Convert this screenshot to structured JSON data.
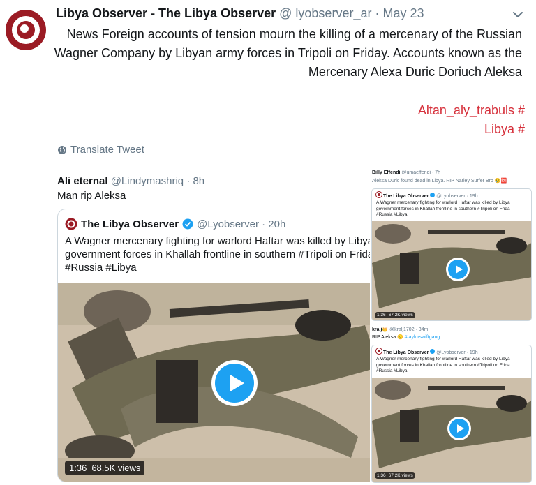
{
  "tweet": {
    "author_name": "Libya Observer - The Libya Observer",
    "handle": "@ lyobserver_ar",
    "separator": "·",
    "date": "May 23",
    "body": "News Foreign accounts of tension mourn the killing of a mercenary of the Russian Wagner Company by Libyan army forces in Tripoli on Friday. Accounts known as the Mercenary Alexa Duric Doriuch Aleksa",
    "hashtags": [
      "Altan_aly_trabuls #",
      "Libya #"
    ],
    "translate_label": "Translate Tweet",
    "icons": {
      "avatar": "libya-observer-logo",
      "menu": "chevron-down-icon",
      "translate": "globe-icon"
    }
  },
  "embedded_reply": {
    "author_name": "Ali eternal",
    "handle": "@Lindymashriq · 8h",
    "text": "Man rip Aleksa",
    "quoted_tweet": {
      "author_name": "The Libya Observer",
      "handle": "@Lyobserver · 20h",
      "text_lines": [
        "A Wagner mercenary fighting for warlord Haftar was killed by Libya",
        "government forces in Khallah frontline in southern #Tripoli on Frida",
        "#Russia #Libya"
      ],
      "video": {
        "duration": "1:36",
        "views": "68.5K views"
      }
    }
  },
  "side_panel": {
    "top_reply": {
      "author_name": "Billy Effendi",
      "handle": "@umaeffendi · 7h",
      "text": "Aleksa Duric found dead in Libya. RIP Narley Surfer Bro",
      "emoji": "😢🆘",
      "quoted": {
        "author_name": "The Libya Observer",
        "handle": "@Lyobserver · 19h",
        "text_lines": [
          "A Wagner mercenary fighting for warlord Haftar was killed by Libya",
          "government forces in Khallah frontline in southern #Tripoli on Frida",
          "#Russia #Libya"
        ],
        "video": {
          "duration": "1:36",
          "views": "67.2K views"
        }
      }
    },
    "bottom_reply": {
      "author_name": "kralj👑",
      "handle": "@kralj1702 · 34m",
      "text": "RIP Aleksa 😢 ",
      "hashtag": "#taylorswiftgang",
      "quoted": {
        "author_name": "The Libya Observer",
        "handle": "@Lyobserver · 19h",
        "text_lines": [
          "A Wagner mercenary fighting for warlord Haftar was killed by Libya",
          "government forces in Khallah frontline in southern #Tripoli on Frida",
          "#Russia #Libya"
        ],
        "video": {
          "duration": "1:36",
          "views": "67.2K views"
        }
      }
    }
  },
  "colors": {
    "text_primary": "#14171a",
    "text_secondary": "#657786",
    "hashtag_red": "#d6303b",
    "twitter_blue": "#1da1f2",
    "border": "#ccd6dd",
    "brand_red": "#9b1b24"
  }
}
